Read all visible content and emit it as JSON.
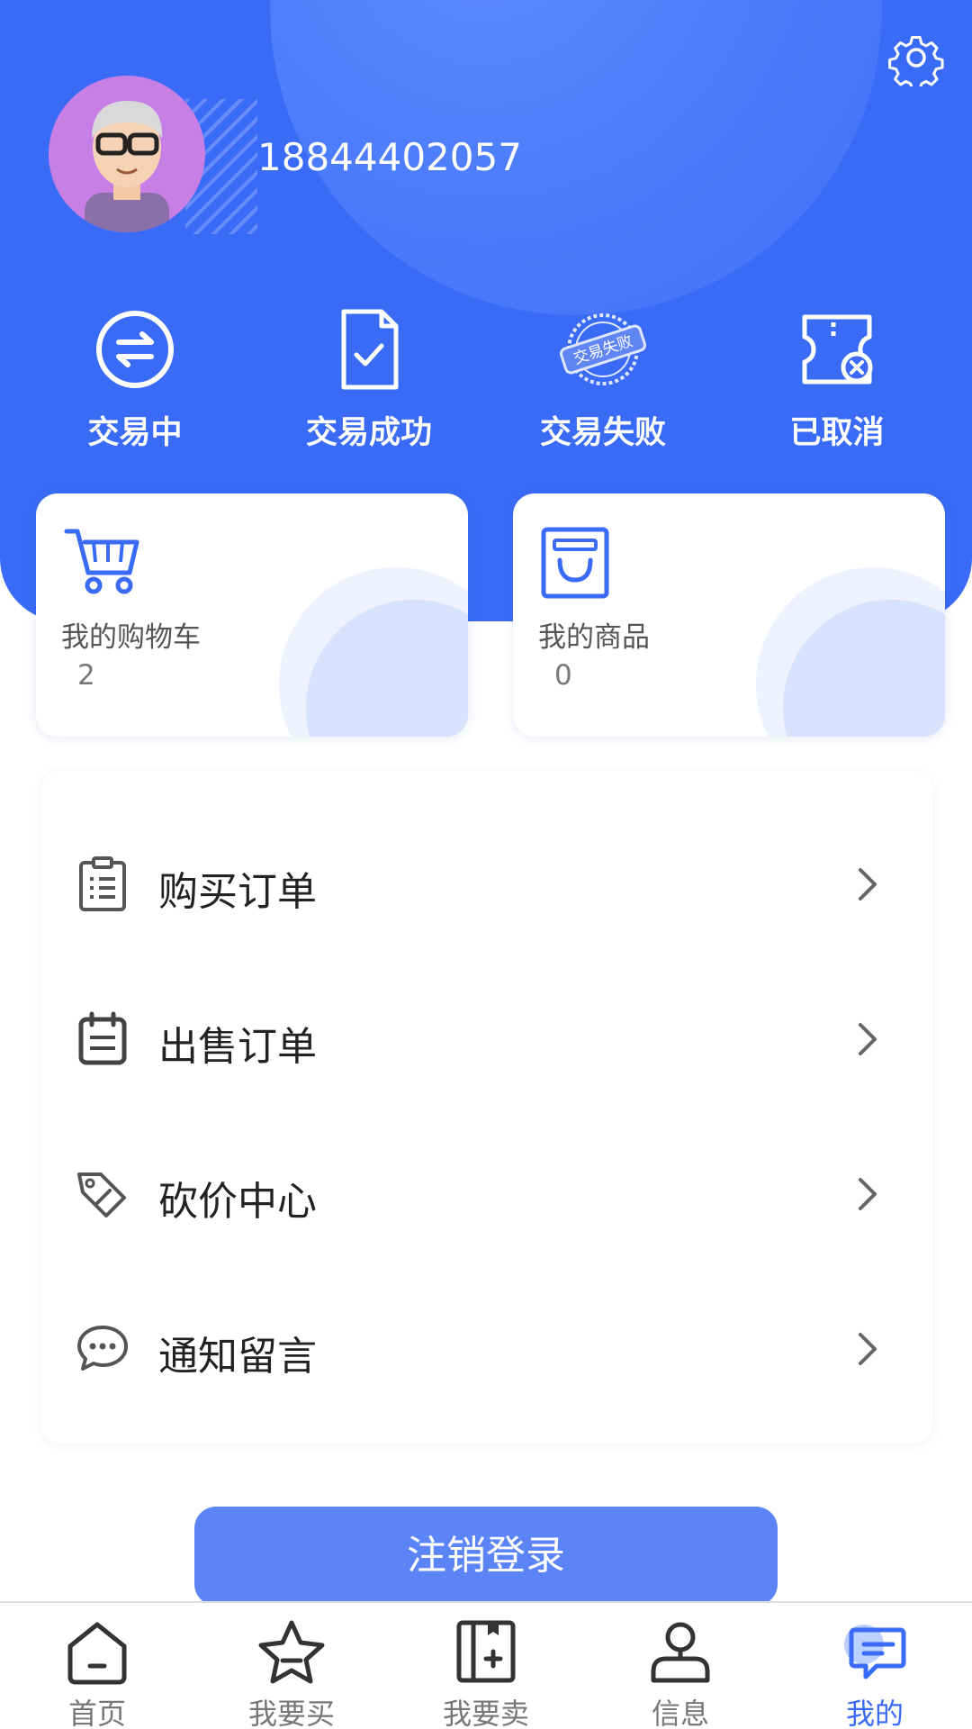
{
  "user": {
    "phone": "18844402057"
  },
  "status": [
    {
      "label": "交易中",
      "icon": "exchange-icon"
    },
    {
      "label": "交易成功",
      "icon": "success-doc-icon"
    },
    {
      "label": "交易失败",
      "icon": "fail-stamp-icon",
      "stamp_text": "交易失败"
    },
    {
      "label": "已取消",
      "icon": "cancelled-ticket-icon"
    }
  ],
  "cards": [
    {
      "title": "我的购物车",
      "count": "2",
      "icon": "cart-icon"
    },
    {
      "title": "我的商品",
      "count": "0",
      "icon": "goods-bag-icon"
    }
  ],
  "menu": [
    {
      "label": "购买订单",
      "icon": "clipboard-icon"
    },
    {
      "label": "出售订单",
      "icon": "calendar-list-icon"
    },
    {
      "label": "砍价中心",
      "icon": "price-tag-icon"
    },
    {
      "label": "通知留言",
      "icon": "chat-bubble-icon"
    }
  ],
  "logout_label": "注销登录",
  "tabs": [
    {
      "label": "首页",
      "icon": "home-icon"
    },
    {
      "label": "我要买",
      "icon": "star-icon"
    },
    {
      "label": "我要卖",
      "icon": "sell-box-icon"
    },
    {
      "label": "信息",
      "icon": "person-icon"
    },
    {
      "label": "我的",
      "icon": "mine-message-icon",
      "active": true
    }
  ],
  "colors": {
    "primary": "#3a6bf6",
    "button": "#5b84f7",
    "avatar_bg": "#c77fe6"
  }
}
